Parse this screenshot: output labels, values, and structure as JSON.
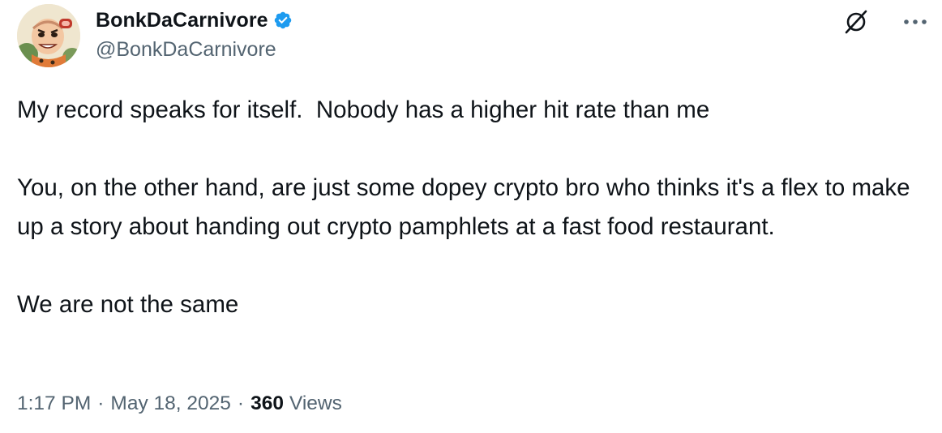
{
  "author": {
    "display_name": "BonkDaCarnivore",
    "handle": "@BonkDaCarnivore",
    "verified": true,
    "verified_color": "#1d9bf0"
  },
  "tweet": {
    "paragraphs": [
      "My record speaks for itself.  Nobody has a higher hit rate than me",
      "You, on the other hand, are just some dopey crypto bro who thinks it's a flex to make up a story about handing out crypto pamphlets at a fast food restaurant.",
      "We are not the same"
    ]
  },
  "meta": {
    "time": "1:17 PM",
    "separator": "·",
    "date": "May 18, 2025",
    "views_count": "360",
    "views_label": "Views"
  },
  "icons": {
    "grok": "grok-icon",
    "more": "more-icon",
    "verified": "verified-badge-icon"
  }
}
